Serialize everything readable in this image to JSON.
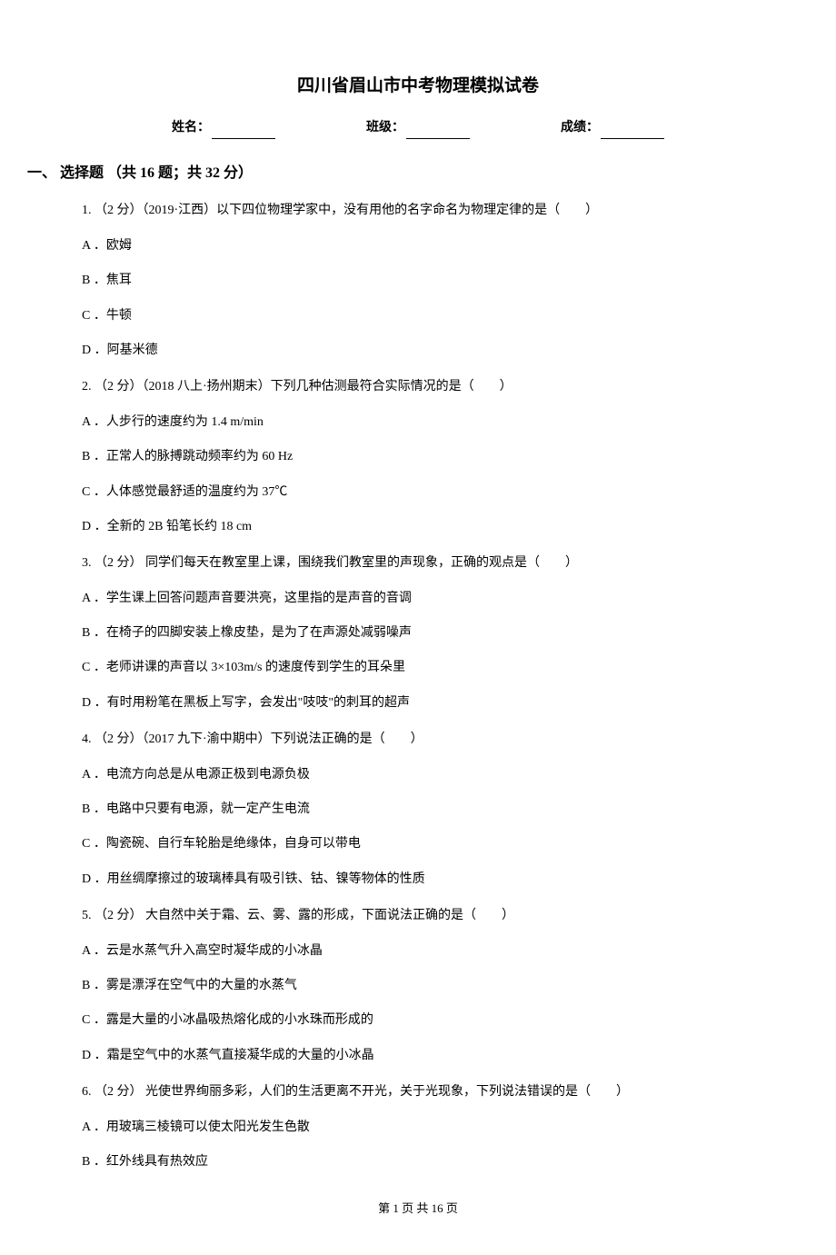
{
  "title": "四川省眉山市中考物理模拟试卷",
  "info": {
    "name_label": "姓名：",
    "class_label": "班级：",
    "score_label": "成绩："
  },
  "section_header": "一、 选择题 （共 16 题；共 32 分）",
  "questions": [
    {
      "text": "1. （2 分）（2019·江西）以下四位物理学家中，没有用他的名字命名为物理定律的是（　　）",
      "options": [
        "A ．欧姆",
        "B ．焦耳",
        "C ．牛顿",
        "D ．阿基米德"
      ]
    },
    {
      "text": "2. （2 分）（2018 八上·扬州期末）下列几种估测最符合实际情况的是（　　）",
      "options": [
        "A ．人步行的速度约为 1.4 m/min",
        "B ．正常人的脉搏跳动频率约为 60 Hz",
        "C ．人体感觉最舒适的温度约为 37℃",
        "D ．全新的 2B 铅笔长约 18 cm"
      ]
    },
    {
      "text": "3. （2 分） 同学们每天在教室里上课，围绕我们教室里的声现象，正确的观点是（　　）",
      "options": [
        "A ．学生课上回答问题声音要洪亮，这里指的是声音的音调",
        "B ．在椅子的四脚安装上橡皮垫，是为了在声源处减弱噪声",
        "C ．老师讲课的声音以 3×103m/s 的速度传到学生的耳朵里",
        "D ．有时用粉笔在黑板上写字，会发出\"吱吱\"的刺耳的超声"
      ]
    },
    {
      "text": "4. （2 分）（2017 九下·渝中期中）下列说法正确的是（　　）",
      "options": [
        "A ．电流方向总是从电源正极到电源负极",
        "B ．电路中只要有电源，就一定产生电流",
        "C ．陶瓷碗、自行车轮胎是绝缘体，自身可以带电",
        "D ．用丝绸摩擦过的玻璃棒具有吸引铁、钴、镍等物体的性质"
      ]
    },
    {
      "text": "5. （2 分） 大自然中关于霜、云、雾、露的形成，下面说法正确的是（　　）",
      "options": [
        "A ．云是水蒸气升入高空时凝华成的小冰晶",
        "B ．雾是漂浮在空气中的大量的水蒸气",
        "C ．露是大量的小冰晶吸热熔化成的小水珠而形成的",
        "D ．霜是空气中的水蒸气直接凝华成的大量的小冰晶"
      ]
    },
    {
      "text": "6. （2 分） 光使世界绚丽多彩，人们的生活更离不开光，关于光现象，下列说法错误的是（　　）",
      "options": [
        "A ．用玻璃三棱镜可以使太阳光发生色散",
        "B ．红外线具有热效应"
      ]
    }
  ],
  "footer": "第 1 页 共 16 页"
}
